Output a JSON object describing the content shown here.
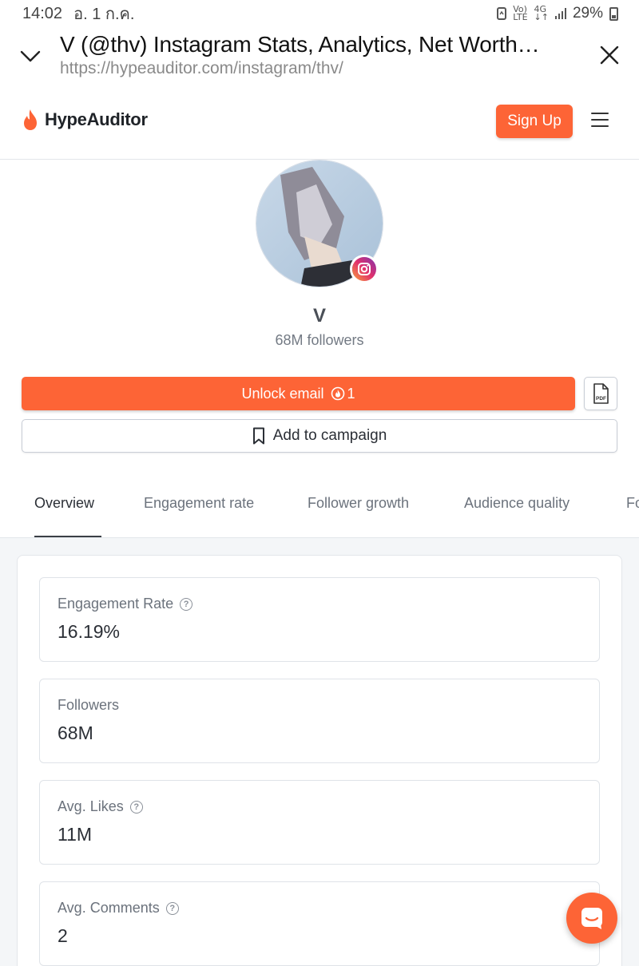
{
  "status_bar": {
    "time": "14:02",
    "date": "อ. 1 ก.ค.",
    "battery": "29%"
  },
  "browser": {
    "page_title": "V (@thv) Instagram Stats, Analytics, Net Worth…",
    "url": "https://hypeauditor.com/instagram/thv/"
  },
  "navbar": {
    "brand": "HypeAuditor",
    "signup_label": "Sign Up"
  },
  "profile": {
    "name": "V",
    "followers_text": "68M followers"
  },
  "actions": {
    "unlock_label": "Unlock email",
    "unlock_count": "1",
    "pdf_label": "PDF",
    "campaign_label": "Add to campaign"
  },
  "tabs": [
    {
      "label": "Overview",
      "active": true
    },
    {
      "label": "Engagement rate",
      "active": false
    },
    {
      "label": "Follower growth",
      "active": false
    },
    {
      "label": "Audience quality",
      "active": false
    },
    {
      "label": "Fo",
      "active": false
    }
  ],
  "stats": [
    {
      "label": "Engagement Rate",
      "value": "16.19%",
      "help": true
    },
    {
      "label": "Followers",
      "value": "68M",
      "help": false
    },
    {
      "label": "Avg. Likes",
      "value": "11M",
      "help": true
    },
    {
      "label": "Avg. Comments",
      "value": "2",
      "help": true
    }
  ],
  "colors": {
    "accent": "#fd6436",
    "text": "#2b2f36",
    "muted": "#6b727c"
  }
}
